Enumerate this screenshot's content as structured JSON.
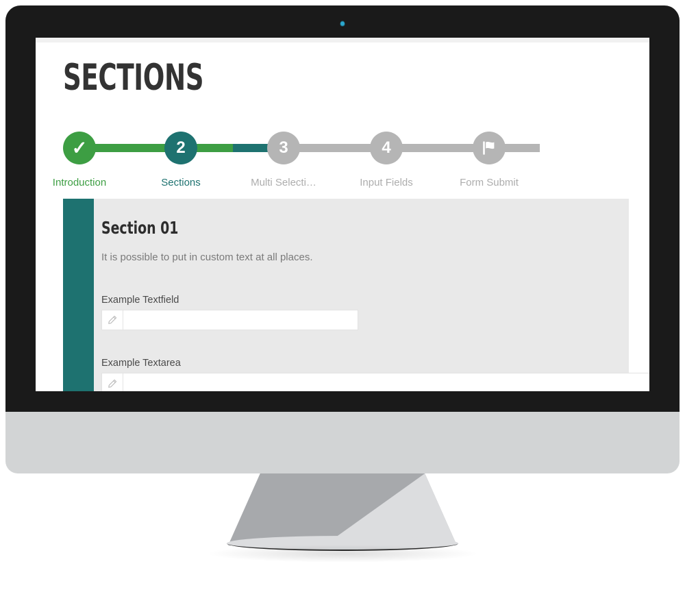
{
  "device": {
    "type": "desktop-monitor",
    "bezel_color": "#1a1a1a",
    "chin_color": "#d2d4d5",
    "webcam_color": "#2ba8cf"
  },
  "page": {
    "title": "SECTIONS"
  },
  "stepper": {
    "steps": [
      {
        "number": "",
        "glyph": "✓",
        "label": "Introduction",
        "state": "done",
        "color": "#3d9e43",
        "icon": "check-icon"
      },
      {
        "number": "2",
        "glyph": "2",
        "label": "Sections",
        "state": "active",
        "color": "#1e7270",
        "icon": ""
      },
      {
        "number": "3",
        "glyph": "3",
        "label": "Multi Selecti…",
        "state": "todo",
        "color": "#b5b5b5",
        "icon": ""
      },
      {
        "number": "4",
        "glyph": "4",
        "label": "Input Fields",
        "state": "todo",
        "color": "#b5b5b5",
        "icon": ""
      },
      {
        "number": "",
        "glyph": "",
        "label": "Form Submit",
        "state": "todo",
        "color": "#b5b5b5",
        "icon": "flag-icon"
      }
    ],
    "connector_colors": [
      "#3d9e43",
      "#1e7270",
      "#b5b5b5",
      "#b5b5b5"
    ]
  },
  "card": {
    "accent_color": "#1e7270",
    "background": "#e9e9e9",
    "heading": "Section 01",
    "description": "It is possible to put in custom text at all places.",
    "fields": [
      {
        "label": "Example Textfield",
        "type": "text",
        "value": "",
        "placeholder": "",
        "icon": "pencil-icon"
      },
      {
        "label": "Example Textarea",
        "type": "textarea",
        "value": "",
        "placeholder": "",
        "icon": "pencil-icon"
      }
    ]
  }
}
